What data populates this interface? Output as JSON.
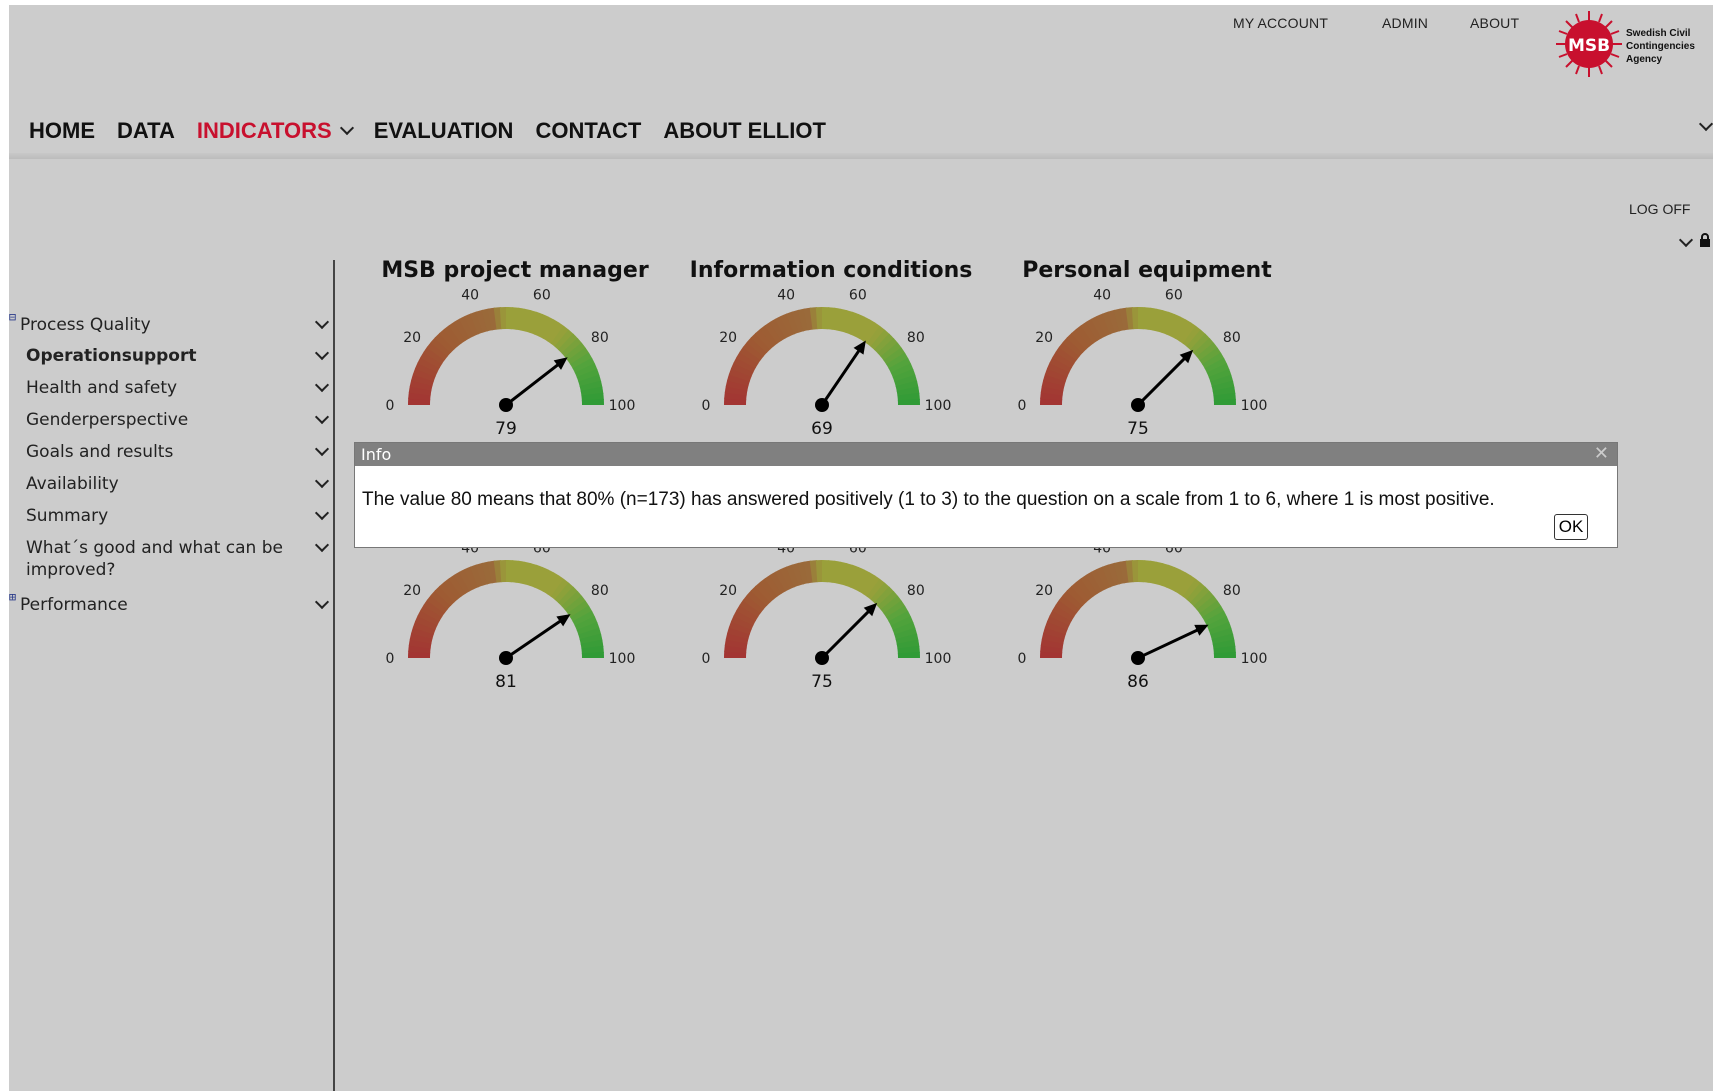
{
  "top_links": {
    "my_account": "MY ACCOUNT",
    "admin": "ADMIN",
    "about": "ABOUT"
  },
  "logo": {
    "mark": "MSB",
    "line1": "Swedish Civil",
    "line2": "Contingencies",
    "line3": "Agency",
    "color": "#c8102e"
  },
  "main_nav": {
    "home": "HOME",
    "data": "DATA",
    "indicators": "INDICATORS",
    "evaluation": "EVALUATION",
    "contact": "CONTACT",
    "about_elliot": "ABOUT ELLIOT",
    "active_color": "#c8102e"
  },
  "logoff": "LOG OFF",
  "sidebar": {
    "items": [
      {
        "label": "Process Quality",
        "expander": "⊟"
      },
      {
        "label": "Operationsupport"
      },
      {
        "label": "Health and safety"
      },
      {
        "label": "Genderperspective"
      },
      {
        "label": "Goals and results"
      },
      {
        "label": "Availability"
      },
      {
        "label": "Summary"
      },
      {
        "label": "What´s good and what can be improved?"
      },
      {
        "label": "Performance",
        "expander": "⊞"
      }
    ]
  },
  "gauges": {
    "scale_labels": [
      "0",
      "20",
      "40",
      "60",
      "80",
      "100"
    ],
    "row1": [
      {
        "title": "MSB project manager",
        "value": 79
      },
      {
        "title": "Information conditions",
        "value": 69
      },
      {
        "title": "Personal equipment",
        "value": 75
      }
    ],
    "row2": [
      {
        "title": "",
        "value": 81
      },
      {
        "title": "",
        "value": 75
      },
      {
        "title": "",
        "value": 86
      }
    ],
    "colors": [
      "#a33333",
      "#9e5b33",
      "#9aa03a",
      "#53a33c",
      "#2e9a36"
    ]
  },
  "info_dialog": {
    "title": "Info",
    "close_glyph": "✕",
    "message": "The value 80 means that 80% (n=173) has answered positively (1 to 3) to the question on a scale from 1 to 6, where 1 is most positive.",
    "ok_label": "OK"
  }
}
